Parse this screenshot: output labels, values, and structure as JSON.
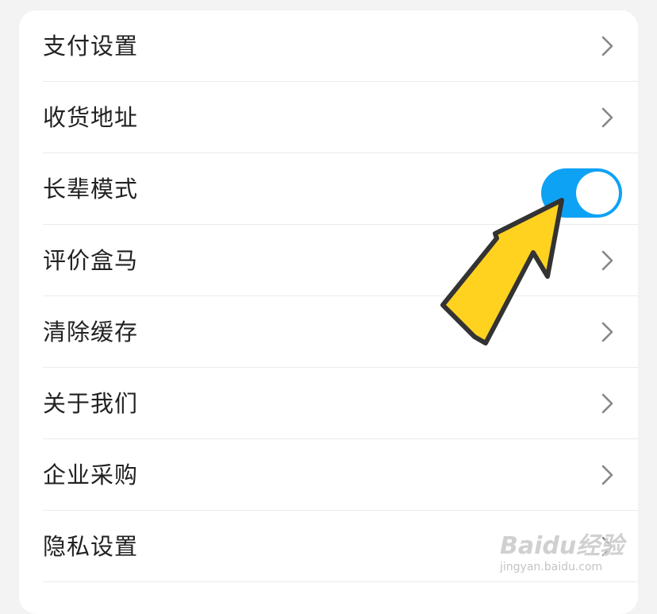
{
  "settings": {
    "items": [
      {
        "label": "支付设置",
        "control": "chevron"
      },
      {
        "label": "收货地址",
        "control": "chevron"
      },
      {
        "label": "长辈模式",
        "control": "toggle",
        "toggle_on": true
      },
      {
        "label": "评价盒马",
        "control": "chevron"
      },
      {
        "label": "清除缓存",
        "control": "chevron"
      },
      {
        "label": "关于我们",
        "control": "chevron"
      },
      {
        "label": "企业采购",
        "control": "chevron"
      },
      {
        "label": "隐私设置",
        "control": "chevron"
      }
    ]
  },
  "colors": {
    "toggle_active": "#0ea2f5",
    "arrow_fill": "#ffd21f",
    "arrow_stroke": "#333333",
    "label_text": "#222222",
    "chevron": "#888888"
  },
  "watermark": {
    "brand": "Baidu经验",
    "url": "jingyan.baidu.com"
  }
}
